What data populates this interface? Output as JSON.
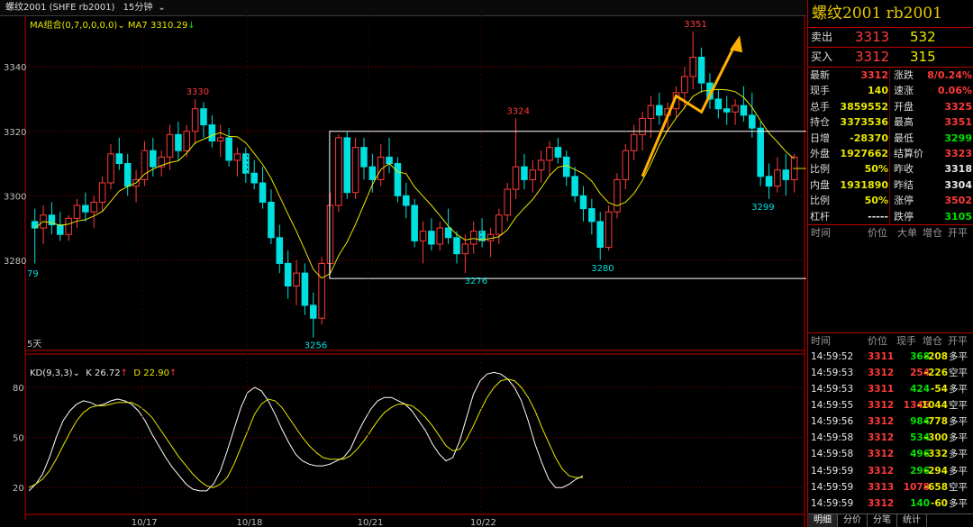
{
  "topbar": {
    "symbol": "螺纹2001 (SHFE rb2001)",
    "period": "15分钟"
  },
  "indicators": {
    "ma_group": "MA组合(0,7,0,0,0,0)",
    "ma7_label": "MA7",
    "ma7_value": "3310.29",
    "kd_label": "KD(9,3,3)",
    "k_label": "K",
    "k_value": "26.72",
    "d_label": "D",
    "d_value": "22.90",
    "days": "5天"
  },
  "price_axis": {
    "ticks": [
      "3340",
      "3320",
      "3300",
      "3280"
    ]
  },
  "kd_axis": {
    "ticks": [
      "80",
      "50",
      "20"
    ]
  },
  "date_axis": {
    "ticks": [
      "10/17",
      "10/18",
      "10/21",
      "10/22"
    ]
  },
  "annotations": {
    "p3330": "3330",
    "p3324": "3324",
    "p3351": "3351",
    "p3276": "3276",
    "p3280": "3280",
    "p3299": "3299",
    "p3256": "3256",
    "p79": "79"
  },
  "colors": {
    "up": "#ff3a3a",
    "down": "#00e0e0",
    "ma": "#e8e800",
    "k": "#ffffff",
    "d": "#e8e800",
    "box": "#ffffff",
    "arrow": "#ffb000"
  },
  "chart_data": [
    {
      "type": "line",
      "title": "螺纹2001 15分钟",
      "candles": [
        {
          "o": 3292,
          "h": 3296,
          "l": 3279,
          "c": 3290
        },
        {
          "o": 3290,
          "h": 3297,
          "l": 3285,
          "c": 3294
        },
        {
          "o": 3294,
          "h": 3298,
          "l": 3288,
          "c": 3291
        },
        {
          "o": 3291,
          "h": 3295,
          "l": 3286,
          "c": 3288
        },
        {
          "o": 3288,
          "h": 3294,
          "l": 3286,
          "c": 3293
        },
        {
          "o": 3293,
          "h": 3299,
          "l": 3290,
          "c": 3297
        },
        {
          "o": 3297,
          "h": 3301,
          "l": 3292,
          "c": 3295
        },
        {
          "o": 3295,
          "h": 3300,
          "l": 3290,
          "c": 3298
        },
        {
          "o": 3298,
          "h": 3306,
          "l": 3295,
          "c": 3304
        },
        {
          "o": 3304,
          "h": 3316,
          "l": 3302,
          "c": 3313
        },
        {
          "o": 3313,
          "h": 3318,
          "l": 3308,
          "c": 3310
        },
        {
          "o": 3310,
          "h": 3313,
          "l": 3300,
          "c": 3303
        },
        {
          "o": 3303,
          "h": 3308,
          "l": 3298,
          "c": 3305
        },
        {
          "o": 3305,
          "h": 3317,
          "l": 3303,
          "c": 3314
        },
        {
          "o": 3314,
          "h": 3318,
          "l": 3306,
          "c": 3309
        },
        {
          "o": 3309,
          "h": 3314,
          "l": 3306,
          "c": 3312
        },
        {
          "o": 3312,
          "h": 3322,
          "l": 3308,
          "c": 3319
        },
        {
          "o": 3319,
          "h": 3323,
          "l": 3311,
          "c": 3314
        },
        {
          "o": 3314,
          "h": 3322,
          "l": 3312,
          "c": 3320
        },
        {
          "o": 3320,
          "h": 3330,
          "l": 3316,
          "c": 3327
        },
        {
          "o": 3327,
          "h": 3329,
          "l": 3318,
          "c": 3322
        },
        {
          "o": 3322,
          "h": 3325,
          "l": 3315,
          "c": 3317
        },
        {
          "o": 3317,
          "h": 3322,
          "l": 3312,
          "c": 3318
        },
        {
          "o": 3318,
          "h": 3321,
          "l": 3309,
          "c": 3311
        },
        {
          "o": 3311,
          "h": 3315,
          "l": 3306,
          "c": 3313
        },
        {
          "o": 3313,
          "h": 3315,
          "l": 3304,
          "c": 3307
        },
        {
          "o": 3307,
          "h": 3311,
          "l": 3302,
          "c": 3304
        },
        {
          "o": 3304,
          "h": 3309,
          "l": 3296,
          "c": 3298
        },
        {
          "o": 3298,
          "h": 3302,
          "l": 3285,
          "c": 3287
        },
        {
          "o": 3287,
          "h": 3291,
          "l": 3276,
          "c": 3279
        },
        {
          "o": 3279,
          "h": 3283,
          "l": 3268,
          "c": 3272
        },
        {
          "o": 3272,
          "h": 3280,
          "l": 3266,
          "c": 3276
        },
        {
          "o": 3276,
          "h": 3279,
          "l": 3263,
          "c": 3266
        },
        {
          "o": 3266,
          "h": 3270,
          "l": 3256,
          "c": 3262
        },
        {
          "o": 3262,
          "h": 3281,
          "l": 3260,
          "c": 3279
        },
        {
          "o": 3279,
          "h": 3301,
          "l": 3276,
          "c": 3297
        },
        {
          "o": 3297,
          "h": 3319,
          "l": 3295,
          "c": 3318
        },
        {
          "o": 3318,
          "h": 3320,
          "l": 3299,
          "c": 3301
        },
        {
          "o": 3301,
          "h": 3318,
          "l": 3299,
          "c": 3315
        },
        {
          "o": 3315,
          "h": 3318,
          "l": 3305,
          "c": 3309
        },
        {
          "o": 3309,
          "h": 3313,
          "l": 3301,
          "c": 3305
        },
        {
          "o": 3305,
          "h": 3316,
          "l": 3303,
          "c": 3312
        },
        {
          "o": 3312,
          "h": 3318,
          "l": 3307,
          "c": 3310
        },
        {
          "o": 3310,
          "h": 3312,
          "l": 3298,
          "c": 3300
        },
        {
          "o": 3300,
          "h": 3304,
          "l": 3293,
          "c": 3297
        },
        {
          "o": 3297,
          "h": 3299,
          "l": 3284,
          "c": 3286
        },
        {
          "o": 3286,
          "h": 3292,
          "l": 3279,
          "c": 3289
        },
        {
          "o": 3289,
          "h": 3293,
          "l": 3283,
          "c": 3285
        },
        {
          "o": 3285,
          "h": 3292,
          "l": 3283,
          "c": 3290
        },
        {
          "o": 3290,
          "h": 3296,
          "l": 3285,
          "c": 3287
        },
        {
          "o": 3287,
          "h": 3289,
          "l": 3279,
          "c": 3282
        },
        {
          "o": 3282,
          "h": 3288,
          "l": 3276,
          "c": 3285
        },
        {
          "o": 3285,
          "h": 3292,
          "l": 3282,
          "c": 3289
        },
        {
          "o": 3289,
          "h": 3293,
          "l": 3284,
          "c": 3286
        },
        {
          "o": 3286,
          "h": 3290,
          "l": 3281,
          "c": 3288
        },
        {
          "o": 3288,
          "h": 3296,
          "l": 3285,
          "c": 3294
        },
        {
          "o": 3294,
          "h": 3304,
          "l": 3292,
          "c": 3302
        },
        {
          "o": 3302,
          "h": 3324,
          "l": 3299,
          "c": 3309
        },
        {
          "o": 3309,
          "h": 3313,
          "l": 3302,
          "c": 3305
        },
        {
          "o": 3305,
          "h": 3311,
          "l": 3301,
          "c": 3308
        },
        {
          "o": 3308,
          "h": 3314,
          "l": 3304,
          "c": 3311
        },
        {
          "o": 3311,
          "h": 3317,
          "l": 3306,
          "c": 3315
        },
        {
          "o": 3315,
          "h": 3318,
          "l": 3310,
          "c": 3312
        },
        {
          "o": 3312,
          "h": 3314,
          "l": 3303,
          "c": 3306
        },
        {
          "o": 3306,
          "h": 3309,
          "l": 3298,
          "c": 3300
        },
        {
          "o": 3300,
          "h": 3303,
          "l": 3292,
          "c": 3296
        },
        {
          "o": 3296,
          "h": 3299,
          "l": 3288,
          "c": 3292
        },
        {
          "o": 3292,
          "h": 3295,
          "l": 3280,
          "c": 3284
        },
        {
          "o": 3284,
          "h": 3297,
          "l": 3283,
          "c": 3295
        },
        {
          "o": 3295,
          "h": 3307,
          "l": 3293,
          "c": 3305
        },
        {
          "o": 3305,
          "h": 3316,
          "l": 3302,
          "c": 3314
        },
        {
          "o": 3314,
          "h": 3322,
          "l": 3311,
          "c": 3319
        },
        {
          "o": 3319,
          "h": 3326,
          "l": 3314,
          "c": 3324
        },
        {
          "o": 3324,
          "h": 3331,
          "l": 3318,
          "c": 3328
        },
        {
          "o": 3328,
          "h": 3332,
          "l": 3322,
          "c": 3325
        },
        {
          "o": 3325,
          "h": 3329,
          "l": 3320,
          "c": 3327
        },
        {
          "o": 3327,
          "h": 3334,
          "l": 3324,
          "c": 3332
        },
        {
          "o": 3332,
          "h": 3340,
          "l": 3327,
          "c": 3337
        },
        {
          "o": 3337,
          "h": 3351,
          "l": 3333,
          "c": 3343
        },
        {
          "o": 3343,
          "h": 3346,
          "l": 3332,
          "c": 3335
        },
        {
          "o": 3335,
          "h": 3338,
          "l": 3327,
          "c": 3330
        },
        {
          "o": 3330,
          "h": 3333,
          "l": 3324,
          "c": 3327
        },
        {
          "o": 3327,
          "h": 3331,
          "l": 3322,
          "c": 3326
        },
        {
          "o": 3326,
          "h": 3330,
          "l": 3322,
          "c": 3328
        },
        {
          "o": 3328,
          "h": 3334,
          "l": 3323,
          "c": 3325
        },
        {
          "o": 3325,
          "h": 3332,
          "l": 3318,
          "c": 3321
        },
        {
          "o": 3321,
          "h": 3323,
          "l": 3303,
          "c": 3306
        },
        {
          "o": 3306,
          "h": 3310,
          "l": 3299,
          "c": 3303
        },
        {
          "o": 3303,
          "h": 3312,
          "l": 3301,
          "c": 3308
        },
        {
          "o": 3308,
          "h": 3313,
          "l": 3300,
          "c": 3305
        },
        {
          "o": 3305,
          "h": 3313,
          "l": 3301,
          "c": 3312
        }
      ],
      "ylim": [
        3252,
        3356
      ]
    },
    {
      "type": "line",
      "title": "KD(9,3,3)",
      "ylim": [
        5,
        100
      ],
      "series": [
        {
          "name": "K",
          "values": [
            18,
            22,
            28,
            38,
            50,
            60,
            66,
            70,
            72,
            71,
            69,
            70,
            72,
            73,
            72,
            70,
            66,
            60,
            52,
            45,
            38,
            32,
            27,
            22,
            19,
            18,
            18,
            22,
            30,
            42,
            55,
            68,
            77,
            80,
            78,
            72,
            64,
            55,
            47,
            40,
            36,
            34,
            33,
            33,
            34,
            36,
            38,
            43,
            52,
            60,
            67,
            72,
            74,
            74,
            72,
            70,
            66,
            60,
            54,
            46,
            40,
            36,
            38,
            48,
            62,
            76,
            84,
            88,
            89,
            88,
            85,
            80,
            72,
            60,
            46,
            35,
            25,
            20,
            20,
            22,
            25,
            27
          ]
        },
        {
          "name": "D",
          "values": [
            20,
            22,
            25,
            30,
            37,
            45,
            53,
            60,
            65,
            68,
            69,
            69,
            70,
            71,
            71,
            71,
            69,
            66,
            62,
            56,
            50,
            44,
            38,
            33,
            28,
            24,
            21,
            20,
            22,
            26,
            34,
            44,
            54,
            64,
            70,
            73,
            72,
            68,
            62,
            56,
            50,
            45,
            41,
            38,
            37,
            37,
            37,
            39,
            43,
            48,
            54,
            60,
            65,
            68,
            70,
            70,
            69,
            66,
            62,
            57,
            51,
            45,
            42,
            43,
            49,
            57,
            66,
            74,
            80,
            84,
            85,
            84,
            80,
            74,
            66,
            56,
            47,
            38,
            31,
            27,
            26,
            26
          ]
        }
      ]
    }
  ],
  "panel": {
    "title": "螺纹2001  rb2001",
    "sell": {
      "label": "卖出",
      "price": "3313",
      "vol": "532"
    },
    "buy": {
      "label": "买入",
      "price": "3312",
      "vol": "315"
    },
    "stats": [
      {
        "a": "最新",
        "b": "3312",
        "bc": "red",
        "c": "涨跌",
        "d": "8/0.24%",
        "dc": "red"
      },
      {
        "a": "现手",
        "b": "140",
        "bc": "yellow",
        "c": "速涨",
        "d": "0.06%",
        "dc": "red"
      },
      {
        "a": "总手",
        "b": "3859552",
        "bc": "yellow",
        "c": "开盘",
        "d": "3325",
        "dc": "red"
      },
      {
        "a": "持仓",
        "b": "3373536",
        "bc": "yellow",
        "c": "最高",
        "d": "3351",
        "dc": "red"
      },
      {
        "a": "日增",
        "b": "-28370",
        "bc": "yellow",
        "c": "最低",
        "d": "3299",
        "dc": "green"
      },
      {
        "a": "外盘",
        "b": "1927662",
        "bc": "yellow",
        "c": "结算价",
        "d": "3323",
        "dc": "red"
      },
      {
        "a": "比例",
        "b": "50%",
        "bc": "yellow",
        "c": "昨收",
        "d": "3318",
        "dc": "white"
      },
      {
        "a": "内盘",
        "b": "1931890",
        "bc": "yellow",
        "c": "昨结",
        "d": "3304",
        "dc": "white"
      },
      {
        "a": "比例",
        "b": "50%",
        "bc": "yellow",
        "c": "涨停",
        "d": "3502",
        "dc": "red"
      },
      {
        "a": "杠杆",
        "b": "-----",
        "bc": "white",
        "c": "跌停",
        "d": "3105",
        "dc": "green"
      }
    ],
    "head1": {
      "t": "时间",
      "p": "价位",
      "v": "大单",
      "z": "增仓",
      "k": "开平"
    },
    "head2": {
      "t": "时间",
      "p": "价位",
      "v": "现手",
      "z": "增仓",
      "k": "开平"
    },
    "ticks": [
      {
        "t": "14:59:52",
        "p": "3311",
        "v": "368",
        "z": "-208",
        "k": "多平"
      },
      {
        "t": "14:59:53",
        "p": "3312",
        "v": "254",
        "z": "-226",
        "k": "空平"
      },
      {
        "t": "14:59:53",
        "p": "3311",
        "v": "424",
        "z": "-54",
        "k": "多平"
      },
      {
        "t": "14:59:55",
        "p": "3312",
        "v": "1346",
        "z": "-1044",
        "k": "空平"
      },
      {
        "t": "14:59:56",
        "p": "3312",
        "v": "984",
        "z": "-778",
        "k": "多平"
      },
      {
        "t": "14:59:58",
        "p": "3312",
        "v": "534",
        "z": "-300",
        "k": "多平"
      },
      {
        "t": "14:59:58",
        "p": "3312",
        "v": "496",
        "z": "-332",
        "k": "多平"
      },
      {
        "t": "14:59:59",
        "p": "3312",
        "v": "296",
        "z": "-294",
        "k": "多平"
      },
      {
        "t": "14:59:59",
        "p": "3313",
        "v": "1078",
        "z": "-658",
        "k": "空平"
      },
      {
        "t": "14:59:59",
        "p": "3312",
        "v": "140",
        "z": "-60",
        "k": "多平"
      }
    ],
    "tabs": [
      "明细",
      "分价",
      "分笔",
      "统计"
    ]
  }
}
